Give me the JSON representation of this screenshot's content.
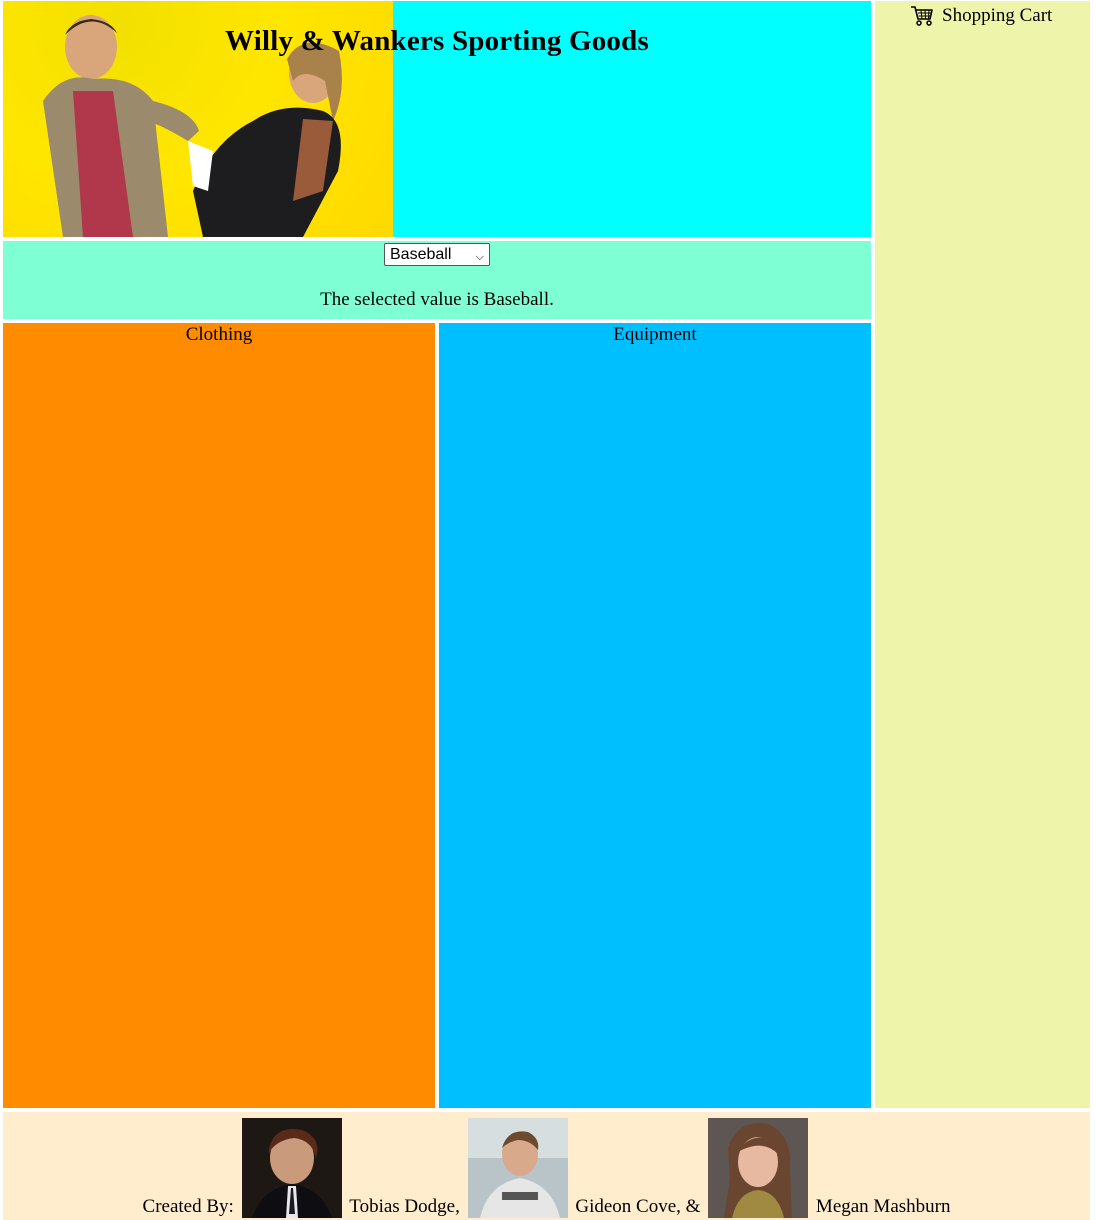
{
  "header": {
    "title": "Willy & Wankers Sporting Goods"
  },
  "sport_selector": {
    "selected_option": "Baseball",
    "status_text": "The selected value is Baseball."
  },
  "sections": {
    "clothing_label": "Clothing",
    "equipment_label": "Equipment"
  },
  "cart": {
    "label": "Shopping Cart",
    "icon": "shopping-cart-icon"
  },
  "footer": {
    "created_by": "Created By:",
    "author1": "Tobias Dodge,",
    "author2": "Gideon Cove, &",
    "author3": "Megan Mashburn"
  },
  "colors": {
    "header_bg": "#00ffff",
    "hero_bg": "#ffe600",
    "selector_bg": "#7fffd4",
    "clothing_bg": "#ff8c00",
    "equipment_bg": "#00bfff",
    "cart_bg": "#eef5aa",
    "footer_bg": "#ffedcd"
  }
}
